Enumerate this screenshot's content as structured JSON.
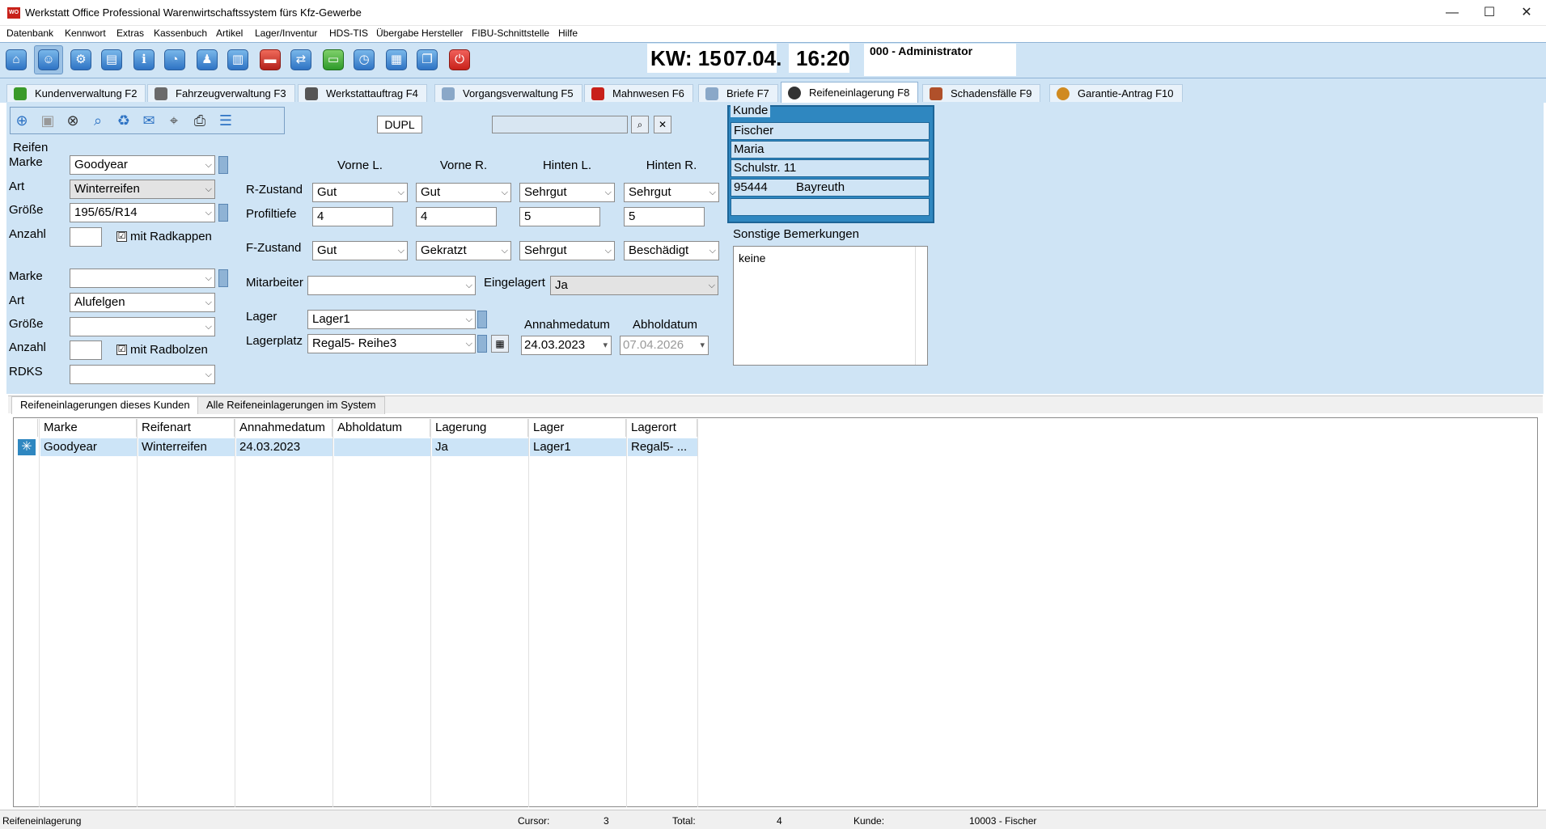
{
  "window": {
    "title": "Werkstatt Office Professional Warenwirtschaftssystem fürs Kfz-Gewerbe",
    "app_icon_text": "WO",
    "minimize": "—",
    "maximize": "☐",
    "close": "✕"
  },
  "menu": [
    "Datenbank",
    "Kennwort",
    "Extras",
    "Kassenbuch",
    "Artikel",
    "Lager/Inventur",
    "HDS-TIS",
    "Übergabe Hersteller",
    "FIBU-Schnittstelle",
    "Hilfe"
  ],
  "toolbar": {
    "kw": "KW: 15",
    "date": "07.04.",
    "time": "16:20",
    "user": "000 - Administrator"
  },
  "tabs": [
    {
      "label": "Kundenverwaltung F2",
      "color": "#3a9a2a"
    },
    {
      "label": "Fahrzeugverwaltung F3",
      "color": "#6a6a6a"
    },
    {
      "label": "Werkstattauftrag F4",
      "color": "#555555"
    },
    {
      "label": "Vorgangsverwaltung F5",
      "color": "#8aa8c8"
    },
    {
      "label": "Mahnwesen F6",
      "color": "#c8211a"
    },
    {
      "label": "Briefe F7",
      "color": "#8aa8c8"
    },
    {
      "label": "Reifeneinlagerung F8",
      "color": "#333333"
    },
    {
      "label": "Schadensfälle F9",
      "color": "#b0502a"
    },
    {
      "label": "Garantie-Antrag F10",
      "color": "#d08a20"
    }
  ],
  "form": {
    "dupl": "DUPL",
    "reifen": {
      "title": "Reifen",
      "marke_label": "Marke",
      "marke": "Goodyear",
      "art_label": "Art",
      "art": "Winterreifen",
      "groesse_label": "Größe",
      "groesse": "195/65/R14",
      "anzahl_label": "Anzahl",
      "anzahl": "",
      "radkappen": "mit Radkappen",
      "radkappen_checked": "☑"
    },
    "felgen": {
      "marke_label": "Marke",
      "marke": "",
      "art_label": "Art",
      "art": "Alufelgen",
      "groesse_label": "Größe",
      "groesse": "",
      "anzahl_label": "Anzahl",
      "anzahl": "",
      "radbolzen": "mit Radbolzen",
      "radbolzen_checked": "☑",
      "rdks_label": "RDKS",
      "rdks": ""
    },
    "positions": {
      "headers": [
        "Vorne L.",
        "Vorne R.",
        "Hinten L.",
        "Hinten R."
      ],
      "r_zustand_label": "R-Zustand",
      "r_zustand": [
        "Gut",
        "Gut",
        "Sehrgut",
        "Sehrgut"
      ],
      "profiltiefe_label": "Profiltiefe",
      "profiltiefe": [
        "4",
        "4",
        "5",
        "5"
      ],
      "f_zustand_label": "F-Zustand",
      "f_zustand": [
        "Gut",
        "Gekratzt",
        "Sehrgut",
        "Beschädigt"
      ]
    },
    "mitarbeiter_label": "Mitarbeiter",
    "mitarbeiter": "",
    "eingelagert_label": "Eingelagert",
    "eingelagert": "Ja",
    "lager_label": "Lager",
    "lager": "Lager1",
    "lagerplatz_label": "Lagerplatz",
    "lagerplatz": "Regal5- Reihe3",
    "annahmedatum_label": "Annahmedatum",
    "annahmedatum": "24.03.2023",
    "abholdatum_label": "Abholdatum",
    "abholdatum": "07.04.2026"
  },
  "kunde": {
    "title": "Kunde",
    "name": "Fischer",
    "vorname": "Maria",
    "strasse": "Schulstr. 11",
    "plz": "95444",
    "ort": "Bayreuth",
    "extra": ""
  },
  "bemerkungen": {
    "label": "Sonstige Bemerkungen",
    "text": "keine"
  },
  "lower_tabs": [
    "Reifeneinlagerungen dieses Kunden",
    "Alle Reifeneinlagerungen im System"
  ],
  "grid": {
    "columns": [
      "Marke",
      "Reifenart",
      "Annahmedatum",
      "Abholdatum",
      "Lagerung",
      "Lager",
      "Lagerort"
    ],
    "rows": [
      [
        "Goodyear",
        "Winterreifen",
        "24.03.2023",
        "",
        "Ja",
        "Lager1",
        "Regal5- ..."
      ]
    ]
  },
  "status": {
    "left": "Reifeneinlagerung",
    "cursor_label": "Cursor:",
    "cursor": "3",
    "total_label": "Total:",
    "total": "4",
    "kunde_label": "Kunde:",
    "kunde": "10003 - Fischer"
  },
  "icons": [
    "add-icon",
    "save-icon",
    "cancel-icon",
    "search-icon",
    "delete-icon",
    "chat-icon",
    "zoom-icon",
    "print-icon",
    "list-icon"
  ]
}
